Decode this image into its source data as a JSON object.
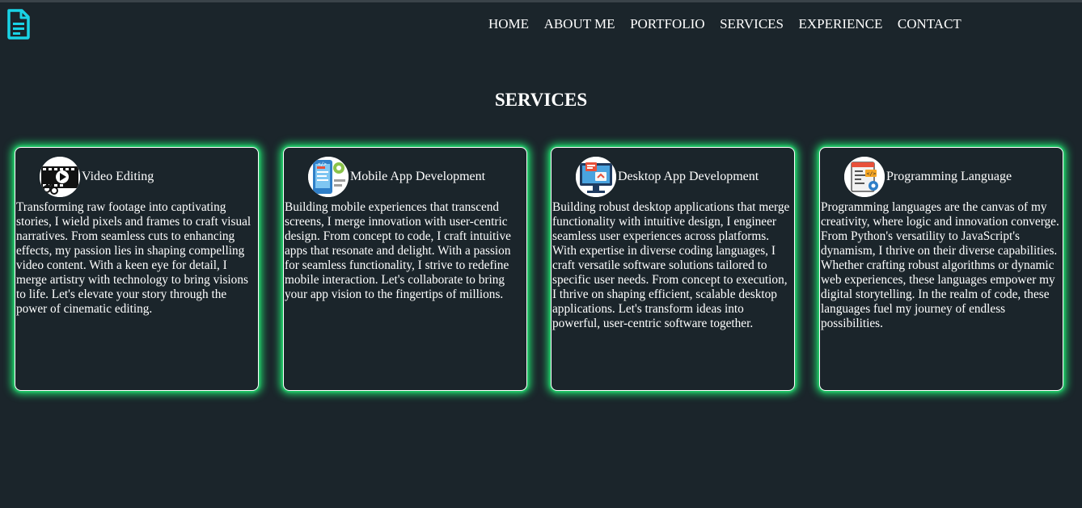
{
  "header": {
    "logo_icon": "document-icon",
    "logo_color": "#19d3e6",
    "nav": [
      {
        "label": "HOME"
      },
      {
        "label": "ABOUT ME"
      },
      {
        "label": "PORTFOLIO"
      },
      {
        "label": "SERVICES"
      },
      {
        "label": "EXPERIENCE"
      },
      {
        "label": "CONTACT"
      }
    ]
  },
  "section": {
    "title": "SERVICES"
  },
  "theme": {
    "background": "#1b252b",
    "glow": "#1fd46a",
    "text": "#ffffff"
  },
  "cards": [
    {
      "icon": "video-editing-icon",
      "title": "Video Editing",
      "text": "Transforming raw footage into captivating stories, I wield pixels and frames to craft visual narratives. From seamless cuts to enhancing effects, my passion lies in shaping compelling video content. With a keen eye for detail, I merge artistry with technology to bring visions to life. Let's elevate your story through the power of cinematic editing."
    },
    {
      "icon": "mobile-app-icon",
      "title": "Mobile App Development",
      "text": "Building mobile experiences that transcend screens, I merge innovation with user-centric design. From concept to code, I craft intuitive apps that resonate and delight. With a passion for seamless functionality, I strive to redefine mobile interaction. Let's collaborate to bring your app vision to the fingertips of millions."
    },
    {
      "icon": "desktop-app-icon",
      "title": "Desktop App Development",
      "text": "Building robust desktop applications that merge functionality with intuitive design, I engineer seamless user experiences across platforms. With expertise in diverse coding languages, I craft versatile software solutions tailored to specific user needs. From concept to execution, I thrive on shaping efficient, scalable desktop applications. Let's transform ideas into powerful, user-centric software together."
    },
    {
      "icon": "programming-language-icon",
      "title": "Programming Language",
      "text": "Programming languages are the canvas of my creativity, where logic and innovation converge. From Python's versatility to JavaScript's dynamism, I thrive on their diverse capabilities. Whether crafting robust algorithms or dynamic web experiences, these languages empower my digital storytelling. In the realm of code, these languages fuel my journey of endless possibilities."
    }
  ]
}
